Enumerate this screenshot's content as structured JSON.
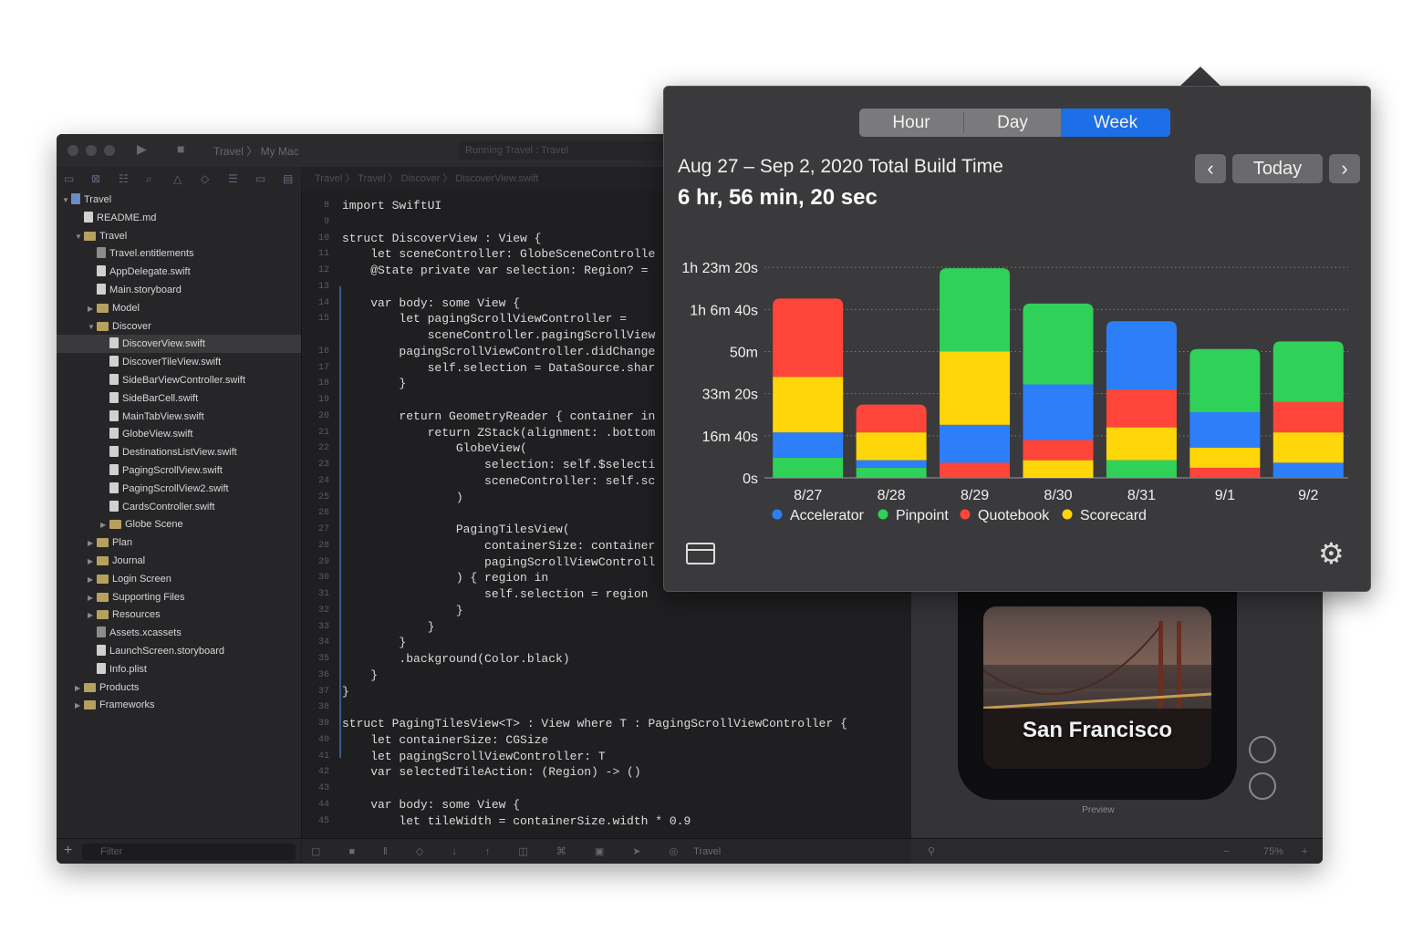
{
  "xcode": {
    "toolbar": {
      "scheme": "Travel",
      "destination": "My Mac",
      "activity": "Running Travel : Travel"
    },
    "jumpbar": {
      "path": "Travel 〉 Travel 〉 Discover 〉 DiscoverView.swift"
    },
    "navigator": {
      "rows": [
        {
          "label": "Travel",
          "depth": 0,
          "kind": "proj",
          "disclosure": "▼"
        },
        {
          "label": "README.md",
          "depth": 1,
          "kind": "file",
          "disclosure": ""
        },
        {
          "label": "Travel",
          "depth": 1,
          "kind": "folder",
          "disclosure": "▼"
        },
        {
          "label": "Travel.entitlements",
          "depth": 2,
          "kind": "asset",
          "disclosure": ""
        },
        {
          "label": "AppDelegate.swift",
          "depth": 2,
          "kind": "file",
          "disclosure": ""
        },
        {
          "label": "Main.storyboard",
          "depth": 2,
          "kind": "file",
          "disclosure": ""
        },
        {
          "label": "Model",
          "depth": 2,
          "kind": "folder",
          "disclosure": "▶"
        },
        {
          "label": "Discover",
          "depth": 2,
          "kind": "folder",
          "disclosure": "▼"
        },
        {
          "label": "DiscoverView.swift",
          "depth": 3,
          "kind": "file",
          "disclosure": "",
          "selected": true
        },
        {
          "label": "DiscoverTileView.swift",
          "depth": 3,
          "kind": "file",
          "disclosure": ""
        },
        {
          "label": "SideBarViewController.swift",
          "depth": 3,
          "kind": "file",
          "disclosure": ""
        },
        {
          "label": "SideBarCell.swift",
          "depth": 3,
          "kind": "file",
          "disclosure": ""
        },
        {
          "label": "MainTabView.swift",
          "depth": 3,
          "kind": "file",
          "disclosure": ""
        },
        {
          "label": "GlobeView.swift",
          "depth": 3,
          "kind": "file",
          "disclosure": ""
        },
        {
          "label": "DestinationsListView.swift",
          "depth": 3,
          "kind": "file",
          "disclosure": ""
        },
        {
          "label": "PagingScrollView.swift",
          "depth": 3,
          "kind": "file",
          "disclosure": ""
        },
        {
          "label": "PagingScrollView2.swift",
          "depth": 3,
          "kind": "file",
          "disclosure": ""
        },
        {
          "label": "CardsController.swift",
          "depth": 3,
          "kind": "file",
          "disclosure": ""
        },
        {
          "label": "Globe Scene",
          "depth": 3,
          "kind": "folder",
          "disclosure": "▶"
        },
        {
          "label": "Plan",
          "depth": 2,
          "kind": "folder",
          "disclosure": "▶"
        },
        {
          "label": "Journal",
          "depth": 2,
          "kind": "folder",
          "disclosure": "▶"
        },
        {
          "label": "Login Screen",
          "depth": 2,
          "kind": "folder",
          "disclosure": "▶"
        },
        {
          "label": "Supporting Files",
          "depth": 2,
          "kind": "folder",
          "disclosure": "▶"
        },
        {
          "label": "Resources",
          "depth": 2,
          "kind": "folder",
          "disclosure": "▶"
        },
        {
          "label": "Assets.xcassets",
          "depth": 2,
          "kind": "asset",
          "disclosure": ""
        },
        {
          "label": "LaunchScreen.storyboard",
          "depth": 2,
          "kind": "file",
          "disclosure": ""
        },
        {
          "label": "Info.plist",
          "depth": 2,
          "kind": "file",
          "disclosure": ""
        },
        {
          "label": "Products",
          "depth": 1,
          "kind": "folder",
          "disclosure": "▶"
        },
        {
          "label": "Frameworks",
          "depth": 1,
          "kind": "folder",
          "disclosure": "▶"
        }
      ],
      "filter_placeholder": "Filter"
    },
    "code": [
      {
        "n": "8",
        "t": "import SwiftUI"
      },
      {
        "n": "9",
        "t": ""
      },
      {
        "n": "10",
        "t": "struct DiscoverView : View {"
      },
      {
        "n": "11",
        "t": "    let sceneController: GlobeSceneControlle"
      },
      {
        "n": "12",
        "t": "    @State private var selection: Region? = "
      },
      {
        "n": "13",
        "t": ""
      },
      {
        "n": "14",
        "t": "    var body: some View {"
      },
      {
        "n": "15",
        "t": "        let pagingScrollViewController ="
      },
      {
        "n": "",
        "t": "            sceneController.pagingScrollView"
      },
      {
        "n": "16",
        "t": "        pagingScrollViewController.didChange"
      },
      {
        "n": "17",
        "t": "            self.selection = DataSource.shar"
      },
      {
        "n": "18",
        "t": "        }"
      },
      {
        "n": "19",
        "t": ""
      },
      {
        "n": "20",
        "t": "        return GeometryReader { container in"
      },
      {
        "n": "21",
        "t": "            return ZStack(alignment: .bottom"
      },
      {
        "n": "22",
        "t": "                GlobeView("
      },
      {
        "n": "23",
        "t": "                    selection: self.$selecti"
      },
      {
        "n": "24",
        "t": "                    sceneController: self.sc"
      },
      {
        "n": "25",
        "t": "                )"
      },
      {
        "n": "26",
        "t": ""
      },
      {
        "n": "27",
        "t": "                PagingTilesView("
      },
      {
        "n": "28",
        "t": "                    containerSize: container"
      },
      {
        "n": "29",
        "t": "                    pagingScrollViewControll"
      },
      {
        "n": "30",
        "t": "                ) { region in"
      },
      {
        "n": "31",
        "t": "                    self.selection = region"
      },
      {
        "n": "32",
        "t": "                }"
      },
      {
        "n": "33",
        "t": "            }"
      },
      {
        "n": "34",
        "t": "        }"
      },
      {
        "n": "35",
        "t": "        .background(Color.black)"
      },
      {
        "n": "36",
        "t": "    }"
      },
      {
        "n": "37",
        "t": "}"
      },
      {
        "n": "38",
        "t": ""
      },
      {
        "n": "39",
        "t": "struct PagingTilesView<T> : View where T : PagingScrollViewController {"
      },
      {
        "n": "40",
        "t": "    let containerSize: CGSize"
      },
      {
        "n": "41",
        "t": "    let pagingScrollViewController: T"
      },
      {
        "n": "42",
        "t": "    var selectedTileAction: (Region) -> ()"
      },
      {
        "n": "43",
        "t": ""
      },
      {
        "n": "44",
        "t": "    var body: some View {"
      },
      {
        "n": "45",
        "t": "        let tileWidth = containerSize.width * 0.9"
      }
    ],
    "debug": {
      "target": "Travel"
    },
    "canvas": {
      "city": "San Francisco",
      "preview_label": "Preview",
      "zoom": "75%"
    }
  },
  "popover": {
    "segments": [
      {
        "label": "Hour",
        "active": false
      },
      {
        "label": "Day",
        "active": false
      },
      {
        "label": "Week",
        "active": true
      }
    ],
    "range_title": "Aug 27 – Sep 2, 2020 Total Build Time",
    "total": "6 hr, 56 min, 20 sec",
    "today_label": "Today",
    "prev_icon": "chevron-left-icon",
    "next_icon": "chevron-right-icon",
    "window_icon": "window-icon",
    "settings_icon": "gear-icon"
  },
  "chart_data": {
    "type": "bar",
    "stacked": true,
    "categories": [
      "8/27",
      "8/28",
      "8/29",
      "8/30",
      "8/31",
      "9/1",
      "9/2"
    ],
    "y_unit": "minutes",
    "ylim": [
      0,
      90
    ],
    "y_ticks": [
      0,
      16.67,
      33.33,
      50,
      66.67,
      83.33
    ],
    "y_tick_labels": [
      "0s",
      "16m 40s",
      "33m 20s",
      "50m",
      "1h 6m 40s",
      "1h 23m 20s"
    ],
    "grid": "horizontal dotted",
    "legend_position": "bottom",
    "series": [
      {
        "name": "Accelerator",
        "color": "#2d7ff9",
        "values": [
          10,
          3,
          15,
          22,
          27,
          14,
          6
        ]
      },
      {
        "name": "Pinpoint",
        "color": "#30d158",
        "values": [
          8,
          4,
          33,
          32,
          7,
          25,
          24
        ]
      },
      {
        "name": "Quotebook",
        "color": "#ff453a",
        "values": [
          31,
          11,
          6,
          8,
          15,
          4,
          12
        ]
      },
      {
        "name": "Scorecard",
        "color": "#ffd60a",
        "values": [
          22,
          11,
          29,
          7,
          13,
          8,
          12
        ]
      }
    ],
    "stack_order_bottom_to_top": [
      [
        "Pinpoint",
        "Accelerator",
        "Scorecard",
        "Quotebook"
      ],
      [
        "Pinpoint",
        "Accelerator",
        "Scorecard",
        "Quotebook"
      ],
      [
        "Quotebook",
        "Accelerator",
        "Scorecard",
        "Pinpoint"
      ],
      [
        "Scorecard",
        "Quotebook",
        "Accelerator",
        "Pinpoint"
      ],
      [
        "Pinpoint",
        "Scorecard",
        "Quotebook",
        "Accelerator"
      ],
      [
        "Quotebook",
        "Scorecard",
        "Accelerator",
        "Pinpoint"
      ],
      [
        "Accelerator",
        "Scorecard",
        "Quotebook",
        "Pinpoint"
      ]
    ]
  }
}
